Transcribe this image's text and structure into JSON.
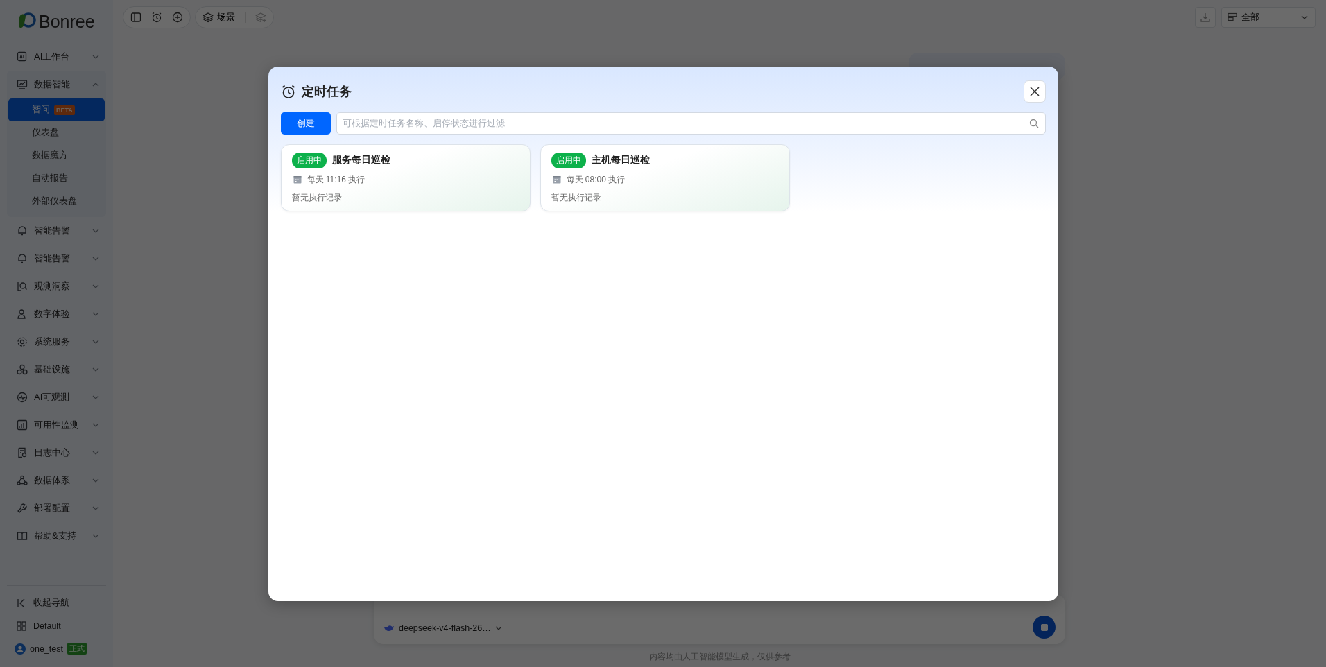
{
  "sidebar": {
    "logo": "Bonree",
    "items": [
      {
        "label": "AI工作台",
        "expanded": false
      },
      {
        "label": "数据智能",
        "expanded": true,
        "children": [
          {
            "label": "智问",
            "badge": "BETA",
            "selected": true
          },
          {
            "label": "仪表盘",
            "selected": false
          },
          {
            "label": "数据魔方",
            "selected": false
          },
          {
            "label": "自动报告",
            "selected": false
          },
          {
            "label": "外部仪表盘",
            "selected": false
          }
        ]
      },
      {
        "label": "智能告警",
        "expanded": false
      },
      {
        "label": "智能告警",
        "expanded": false
      },
      {
        "label": "观测洞察",
        "expanded": false
      },
      {
        "label": "数字体验",
        "expanded": false
      },
      {
        "label": "系统服务",
        "expanded": false
      },
      {
        "label": "基础设施",
        "expanded": false
      },
      {
        "label": "AI可观测",
        "expanded": false
      },
      {
        "label": "可用性监测",
        "expanded": false
      },
      {
        "label": "日志中心",
        "expanded": false
      },
      {
        "label": "数据体系",
        "expanded": false
      },
      {
        "label": "部署配置",
        "expanded": false
      },
      {
        "label": "帮助&支持",
        "expanded": false
      }
    ],
    "bottom": [
      {
        "label": "收起导航"
      },
      {
        "label": "Default"
      }
    ],
    "user": {
      "name": "one_test",
      "badge": "正式"
    }
  },
  "toolbar": {
    "scene": "场景",
    "filter": "全部"
  },
  "chat": {
    "model": "deepseek-v4-flash-26…",
    "footer": "内容均由人工智能模型生成，仅供参考"
  },
  "dialog": {
    "title": "定时任务",
    "create": "创建",
    "search": {
      "placeholder": "可根据定时任务名称、启停状态进行过滤"
    },
    "tasks": [
      {
        "status": "启用中",
        "enabled": true,
        "name": "服务每日巡检",
        "schedule": "每天 11:16 执行",
        "history": "暂无执行记录"
      },
      {
        "status": "启用中",
        "enabled": true,
        "name": "主机每日巡检",
        "schedule": "每天 08:00 执行",
        "history": "暂无执行记录"
      }
    ]
  }
}
